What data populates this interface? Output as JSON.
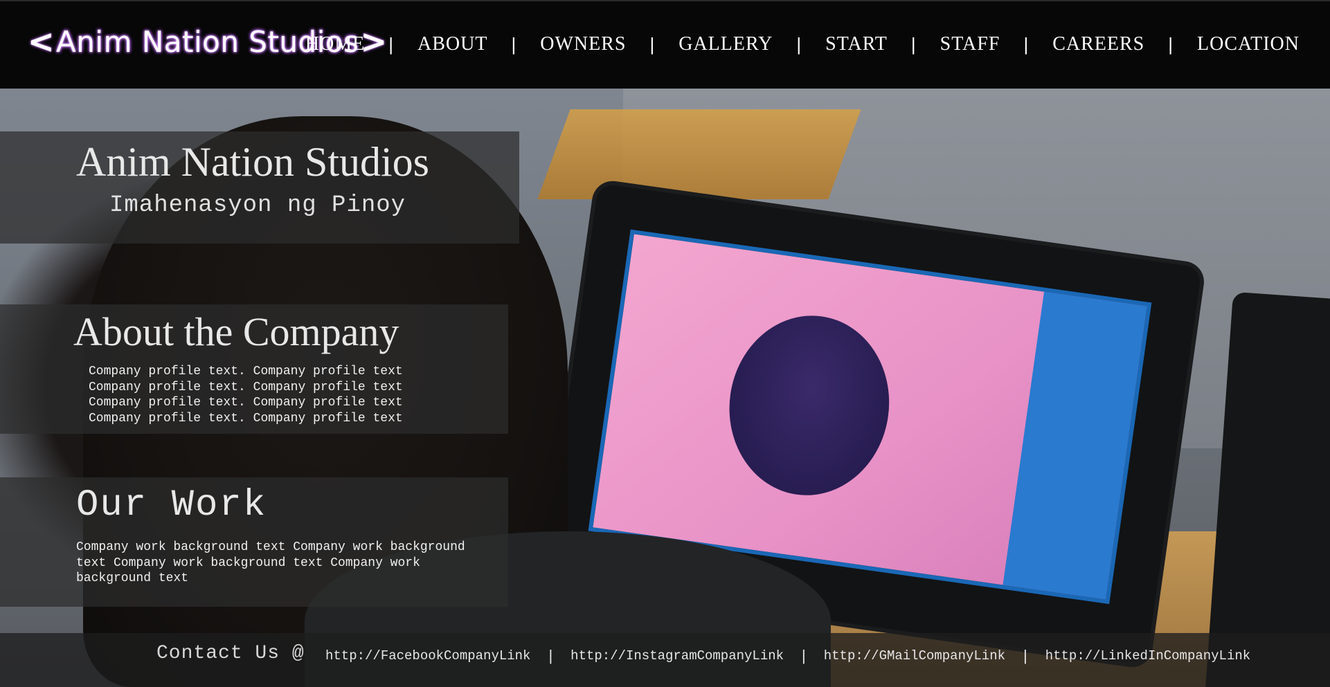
{
  "header": {
    "logo_text": "Anim Nation Studios",
    "logo_left": "<",
    "logo_right": ">",
    "nav": [
      {
        "label": "HOME"
      },
      {
        "label": "ABOUT"
      },
      {
        "label": "OWNERS"
      },
      {
        "label": "GALLERY"
      },
      {
        "label": "START"
      },
      {
        "label": "STAFF"
      },
      {
        "label": "CAREERS"
      },
      {
        "label": "LOCATION"
      }
    ],
    "separator": "|"
  },
  "hero": {
    "title": "Anim Nation Studios",
    "tagline": "Imahenasyon ng Pinoy"
  },
  "about": {
    "title": "About the Company",
    "body": "Company profile text. Company profile text Company profile text. Company profile text Company profile text. Company profile text Company profile text. Company profile text"
  },
  "work": {
    "title": "Our Work",
    "body": "Company work background text Company work background text Company work background text Company work background text"
  },
  "footer": {
    "contact_label": "Contact Us @",
    "separator": "|",
    "links": [
      {
        "label": "http://FacebookCompanyLink"
      },
      {
        "label": "http://InstagramCompanyLink"
      },
      {
        "label": "http://GMailCompanyLink"
      },
      {
        "label": "http://LinkedInCompanyLink"
      }
    ]
  },
  "colors": {
    "header_bg": "#070707",
    "logo_glow": "#c779ff",
    "panel_bg": "#2d2d2d",
    "text": "#ffffff"
  }
}
